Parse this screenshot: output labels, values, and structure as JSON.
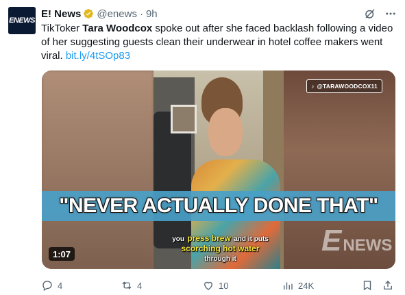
{
  "account": {
    "avatar_text": "ENEWS",
    "name": "E! News",
    "handle": "@enews",
    "separator": "·",
    "time": "9h"
  },
  "tweet": {
    "text_before": "TikToker ",
    "text_bold": "Tara Woodcox",
    "text_after": " spoke out after she faced backlash following a video of her suggesting guests clean their underwear in hotel coffee makers went viral. ",
    "link": "bit.ly/4tSOp83"
  },
  "media": {
    "tiktok_handle": "@TARAWOODCOX11",
    "banner_text": "\"NEVER ACTUALLY DONE THAT\"",
    "subtitle": {
      "w1": "you",
      "y1": "press brew",
      "w2": "and it puts",
      "y2": "scorching hot water",
      "w3": "through it"
    },
    "watermark_e": "E",
    "watermark_news": "NEWS",
    "duration": "1:07"
  },
  "actions": {
    "replies": "4",
    "reposts": "4",
    "likes": "10",
    "views": "24K"
  },
  "colors": {
    "link": "#1d9bf0",
    "muted": "#536471",
    "verified_gold": "#e2b719",
    "banner": "#49a0c8",
    "subtitle_yellow": "#f3e33a"
  }
}
